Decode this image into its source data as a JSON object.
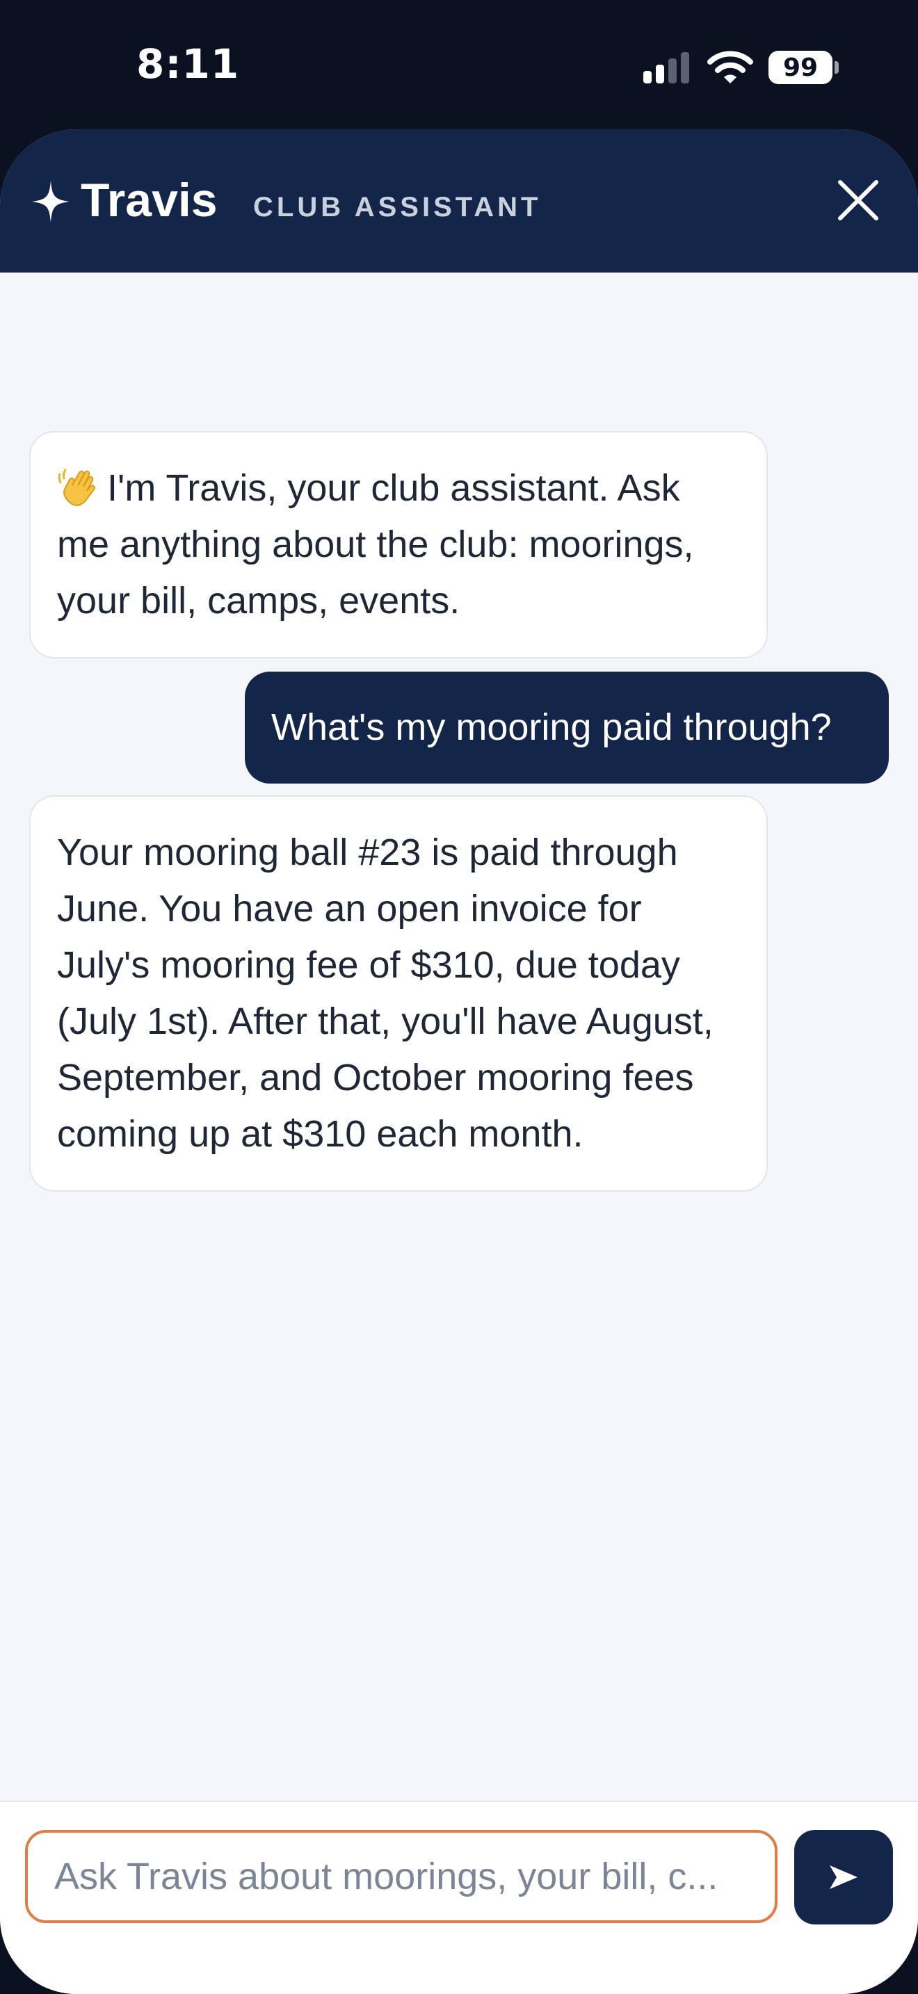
{
  "status_bar": {
    "time": "8:11",
    "battery_level": "99",
    "icons": [
      "signal-icon",
      "wifi-icon",
      "battery-icon"
    ]
  },
  "header": {
    "icon": "sparkle-icon",
    "title": "Travis",
    "subtitle": "CLUB ASSISTANT",
    "close_icon": "close-icon"
  },
  "messages": [
    {
      "role": "assistant",
      "emoji": "waving-hand-icon",
      "text": "I'm Travis, your club assistant. Ask me anything about the club: moorings, your bill, camps, events."
    },
    {
      "role": "user",
      "text": "What's my mooring paid through?"
    },
    {
      "role": "assistant",
      "text": "Your mooring ball #23 is paid through June. You have an open invoice for July's mooring fee of $310, due today (July 1st). After that, you'll have August, September, and October mooring fees coming up at $310 each month."
    }
  ],
  "composer": {
    "placeholder": "Ask Travis about moorings, your bill, c...",
    "value": "",
    "send_icon": "send-icon"
  },
  "colors": {
    "header_bg": "#14254a",
    "accent_border": "#e07c46",
    "background": "#f4f6fa",
    "status_bar_bg": "#0b1120"
  }
}
